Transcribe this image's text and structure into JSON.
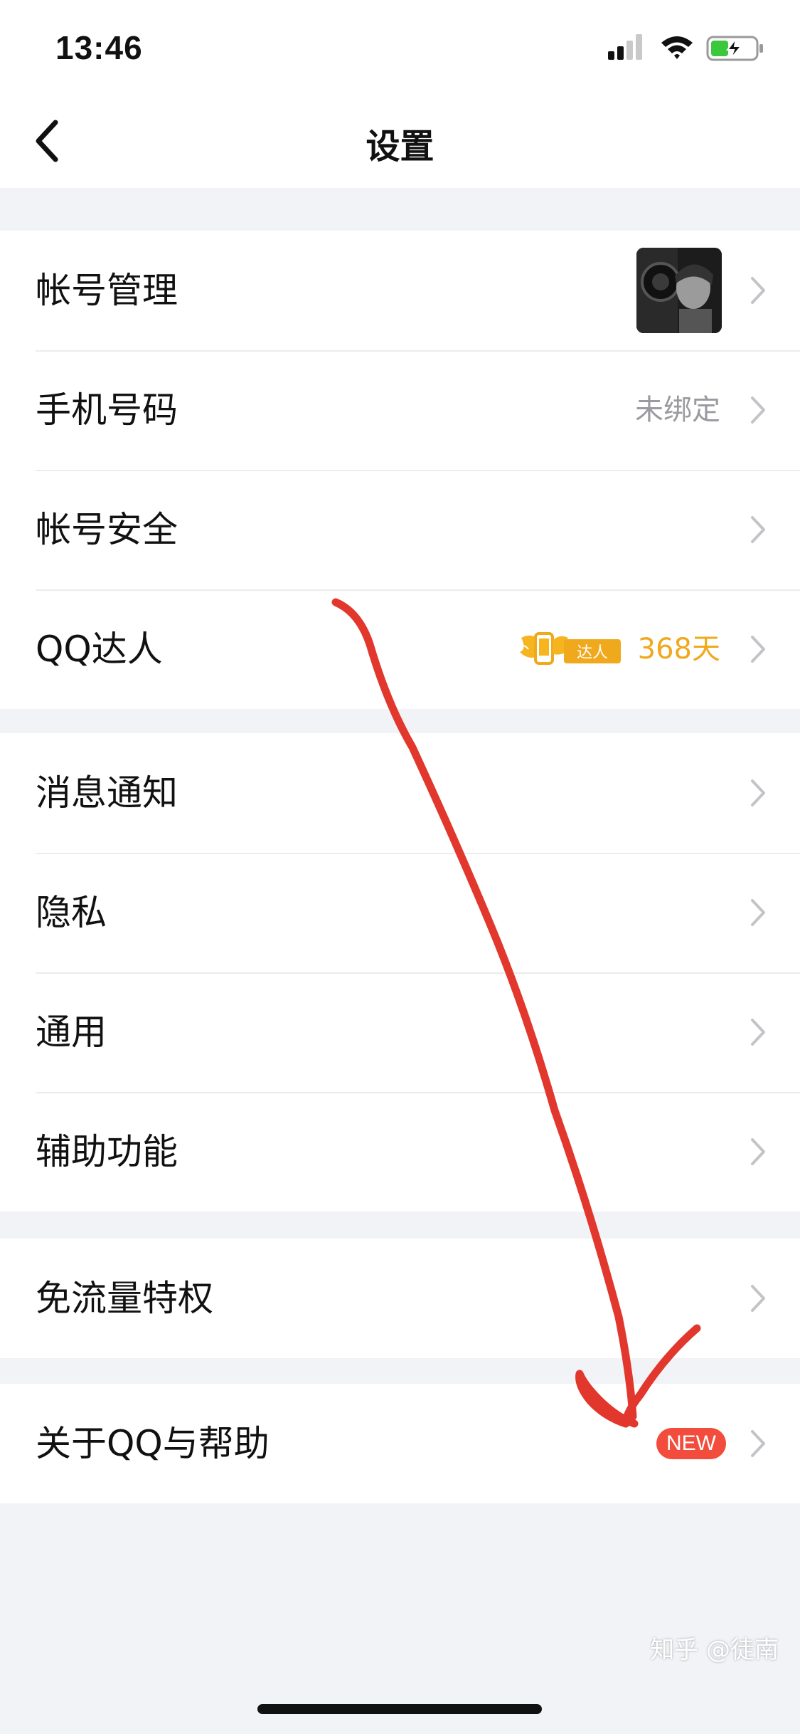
{
  "status_bar": {
    "time": "13:46",
    "icons": [
      "cellular-signal-icon",
      "wifi-icon",
      "battery-charging-icon"
    ],
    "battery_color": "#3cc83c"
  },
  "nav": {
    "title": "设置",
    "back_icon": "chevron-left-icon"
  },
  "groups": [
    {
      "rows": [
        {
          "label": "帐号管理",
          "trailing": "avatar"
        },
        {
          "label": "手机号码",
          "value": "未绑定"
        },
        {
          "label": "帐号安全"
        },
        {
          "label": "QQ达人",
          "badge_text": "达人",
          "days": "368天",
          "badge_color": "#f0a81c"
        }
      ]
    },
    {
      "rows": [
        {
          "label": "消息通知"
        },
        {
          "label": "隐私"
        },
        {
          "label": "通用"
        },
        {
          "label": "辅助功能"
        }
      ]
    },
    {
      "rows": [
        {
          "label": "免流量特权"
        }
      ]
    },
    {
      "rows": [
        {
          "label": "关于QQ与帮助",
          "new_badge": "NEW",
          "new_color": "#f24c3d"
        }
      ]
    }
  ],
  "annotation": {
    "type": "hand-drawn-arrow",
    "color": "#e2372c"
  },
  "watermark": "知乎 @徒南",
  "colors": {
    "background": "#f2f3f7",
    "cell": "#ffffff",
    "text": "#111111",
    "secondary_text": "#9a9aa0"
  }
}
